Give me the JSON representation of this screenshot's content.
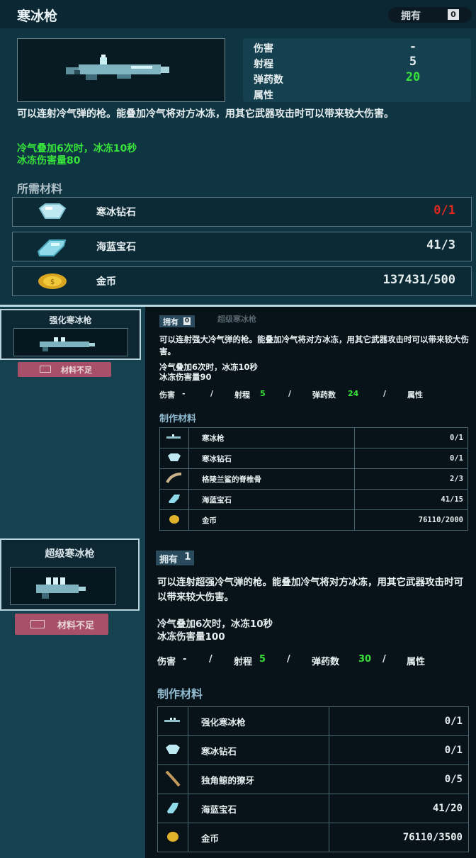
{
  "top": {
    "title": "寒冰枪",
    "owned_label": "拥有",
    "owned_count": "0",
    "stats": [
      {
        "label": "伤害",
        "value": "-"
      },
      {
        "label": "射程",
        "value": "5"
      },
      {
        "label": "弹药数",
        "value": "20"
      },
      {
        "label": "属性",
        "value": ""
      }
    ],
    "description": "可以连射冷气弹的枪。能叠加冷气将对方冰冻，用其它武器攻击时可以带来较大伤害。",
    "effect_line1": "冷气叠加6次时，冰冻10秒",
    "effect_line2": "冰冻伤害量80",
    "materials_title": "所需材料",
    "materials": [
      {
        "icon": "diamond-icon",
        "name": "寒冰钻石",
        "count": "0/1",
        "status": "insufficient"
      },
      {
        "icon": "gem-icon",
        "name": "海蓝宝石",
        "count": "41/3",
        "status": "ok"
      },
      {
        "icon": "coin-icon",
        "name": "金币",
        "count": "137431/500",
        "status": "ok"
      }
    ]
  },
  "mid": {
    "card_title": "强化寒冰枪",
    "no_materials_label": "材料不足",
    "owned_label": "拥有",
    "owned_count": "0",
    "ghost_title": "超级寒冰枪",
    "description": "可以连射强大冷气弹的枪。能叠加冷气将对方冰冻，用其它武器攻击时可以带来较大伤害。",
    "effect_line1": "冷气叠加6次时，冰冻10秒",
    "effect_line2": "冰冻伤害量90",
    "stats": [
      {
        "label": "伤害",
        "value": "-"
      },
      {
        "label": "射程",
        "value": "5"
      },
      {
        "label": "弹药数",
        "value": "24"
      },
      {
        "label": "属性",
        "value": ""
      }
    ],
    "separator": "/",
    "materials_title": "制作材料",
    "materials": [
      {
        "icon": "gun-icon",
        "name": "寒冰枪",
        "count": "0/1",
        "status": "insufficient"
      },
      {
        "icon": "diamond-icon",
        "name": "寒冰钻石",
        "count": "0/1",
        "status": "insufficient"
      },
      {
        "icon": "bone-icon",
        "name": "格陵兰鲨的脊椎骨",
        "count": "2/3",
        "status": "insufficient"
      },
      {
        "icon": "gem-icon",
        "name": "海蓝宝石",
        "count": "41/15",
        "status": "ok"
      },
      {
        "icon": "coin-icon",
        "name": "金币",
        "count": "76110/2000",
        "status": "ok"
      }
    ]
  },
  "bottom": {
    "card_title": "超级寒冰枪",
    "no_materials_label": "材料不足",
    "owned_label": "拥有",
    "owned_count": "1",
    "description": "可以连射超强冷气弹的枪。能叠加冷气将对方冰冻，用其它武器攻击时可以带来较大伤害。",
    "effect_line1": "冷气叠加6次时，冰冻10秒",
    "effect_line2": "冰冻伤害量100",
    "stats": [
      {
        "label": "伤害",
        "value": "-"
      },
      {
        "label": "射程",
        "value": "5"
      },
      {
        "label": "弹药数",
        "value": "30"
      },
      {
        "label": "属性",
        "value": ""
      }
    ],
    "separator": "/",
    "materials_title": "制作材料",
    "materials": [
      {
        "icon": "gun-icon",
        "name": "强化寒冰枪",
        "count": "0/1",
        "status": "insufficient"
      },
      {
        "icon": "diamond-icon",
        "name": "寒冰钻石",
        "count": "0/1",
        "status": "insufficient"
      },
      {
        "icon": "tusk-icon",
        "name": "独角鲸的獠牙",
        "count": "0/5",
        "status": "insufficient"
      },
      {
        "icon": "gem-icon",
        "name": "海蓝宝石",
        "count": "41/20",
        "status": "ok"
      },
      {
        "icon": "coin-icon",
        "name": "金币",
        "count": "76110/3500",
        "status": "ok"
      }
    ]
  },
  "colors": {
    "insufficient": "#e0281f",
    "effect": "#37e23b",
    "stat_value": "#37e23b",
    "no_materials_button": "#a8506a"
  }
}
